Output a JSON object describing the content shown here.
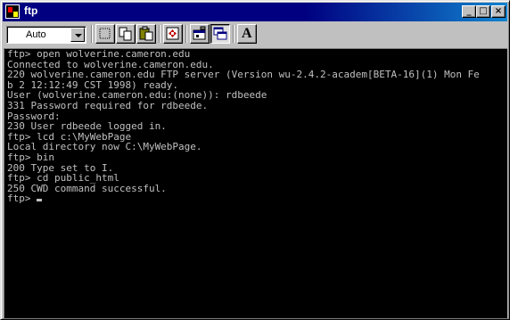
{
  "window": {
    "title": "ftp",
    "controls": {
      "minimize": "_",
      "maximize": "□",
      "close": "×"
    }
  },
  "toolbar": {
    "font_size_value": "Auto",
    "tools": [
      {
        "name": "mark-icon"
      },
      {
        "name": "copy-icon"
      },
      {
        "name": "paste-icon"
      },
      {
        "name": "fullscreen-icon"
      },
      {
        "name": "properties-icon"
      },
      {
        "name": "background-icon"
      },
      {
        "name": "font-icon",
        "glyph": "A"
      }
    ]
  },
  "terminal": {
    "lines": [
      "ftp> open wolverine.cameron.edu",
      "Connected to wolverine.cameron.edu.",
      "220 wolverine.cameron.edu FTP server (Version wu-2.4.2-academ[BETA-16](1) Mon Fe",
      "b 2 12:12:49 CST 1998) ready.",
      "User (wolverine.cameron.edu:(none)): rdbeede",
      "331 Password required for rdbeede.",
      "Password:",
      "230 User rdbeede logged in.",
      "ftp> lcd c:\\MyWebPage",
      "Local directory now C:\\MyWebPage.",
      "ftp> bin",
      "200 Type set to I.",
      "ftp> cd public_html",
      "250 CWD command successful.",
      "ftp> "
    ]
  },
  "colors": {
    "title_bar": "#000080",
    "terminal_bg": "#000000",
    "terminal_fg": "#c0c0c0"
  }
}
